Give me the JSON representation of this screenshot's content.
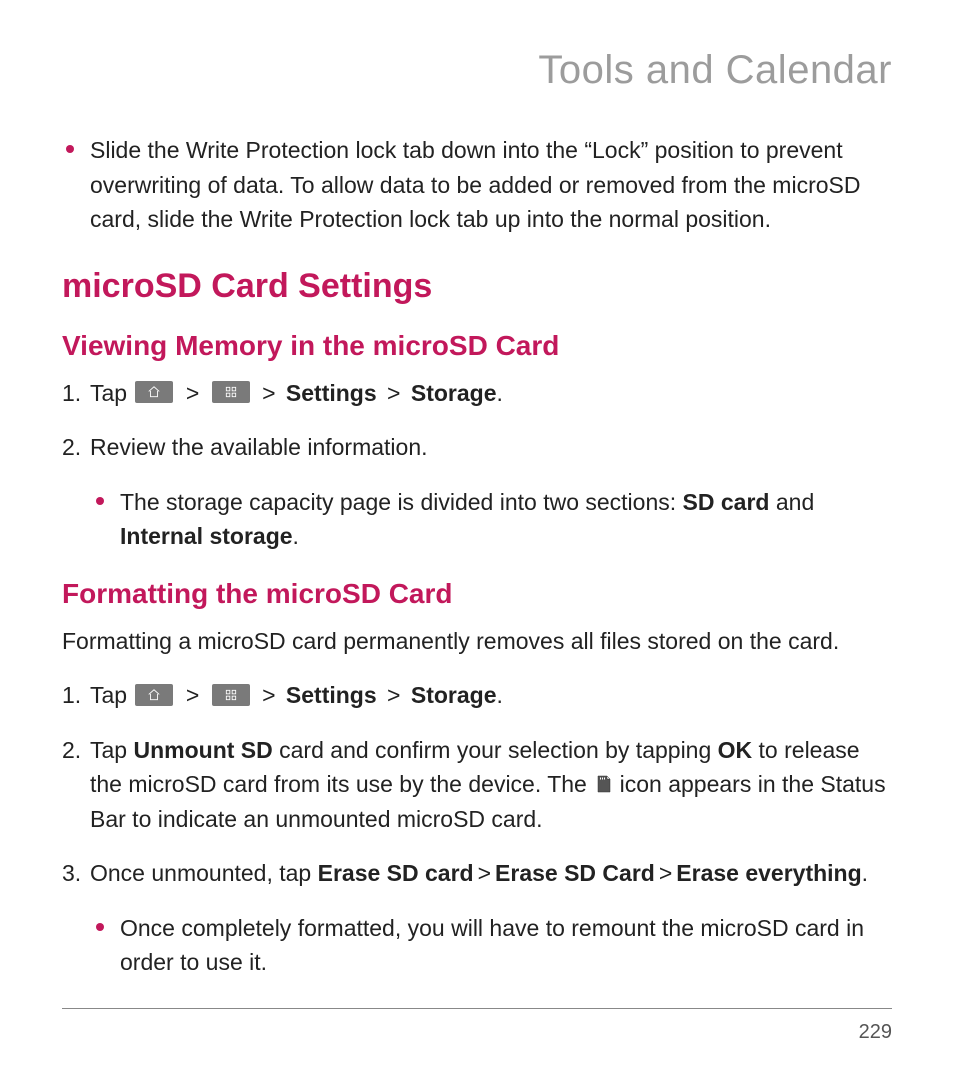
{
  "chapter_title": "Tools and Calendar",
  "intro_bullet": "Slide the Write Protection lock tab down into the “Lock” position to prevent overwriting of data. To allow data to be added or removed from the microSD card, slide the Write Protection lock tab up into the normal position.",
  "section_title": "microSD Card Settings",
  "viewing": {
    "heading": "Viewing Memory in the microSD Card",
    "step1_prefix": "Tap ",
    "sep": ">",
    "settings_label": "Settings",
    "storage_label": "Storage",
    "period": ".",
    "step2": "Review the available information.",
    "sub_bullet_pre": "The storage capacity page is divided into two sections: ",
    "sd_card_label": "SD card",
    "and": " and ",
    "internal_label": "Internal storage"
  },
  "formatting": {
    "heading": "Formatting the microSD Card",
    "intro": "Formatting a microSD card permanently removes all files stored on the card.",
    "step1_prefix": "Tap ",
    "step2_pre": "Tap ",
    "unmount_label": "Unmount SD",
    "step2_mid": " card and confirm your selection by tapping ",
    "ok_label": "OK",
    "step2_after_ok": " to release the microSD card from its use by the device. The ",
    "step2_tail": " icon appears in the Status Bar to indicate an unmounted microSD card.",
    "step3_pre": "Once unmounted, tap ",
    "erase1": "Erase SD card",
    "erase2": "Erase SD Card",
    "erase3": "Erase everything",
    "sub_bullet": "Once completely formatted, you will have to remount the microSD card in order to use it."
  },
  "page_number": "229"
}
